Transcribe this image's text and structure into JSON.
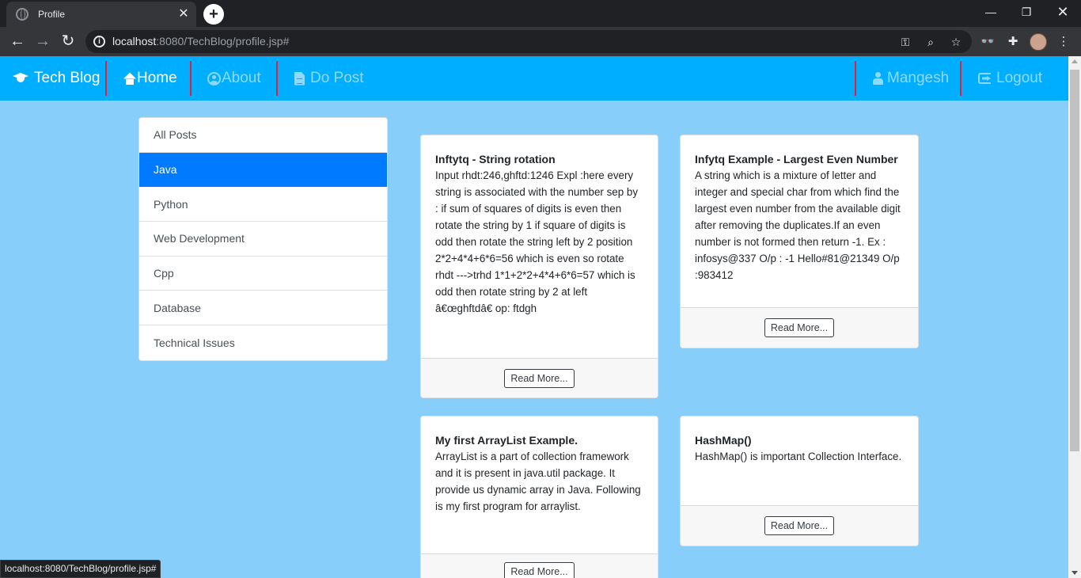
{
  "browser": {
    "tab_title": "Profile",
    "url_host": "localhost",
    "url_rest": ":8080/TechBlog/profile.jsp#",
    "status_url": "localhost:8080/TechBlog/profile.jsp#"
  },
  "navbar": {
    "brand": "Tech Blog",
    "home": "Home",
    "about": "About",
    "do_post": "Do Post",
    "user": "Mangesh",
    "logout": "Logout",
    "background": "#00aeff",
    "separator_color": "#d9253b"
  },
  "categories": [
    {
      "label": "All Posts"
    },
    {
      "label": "Java",
      "active": true
    },
    {
      "label": "Python"
    },
    {
      "label": "Web Development"
    },
    {
      "label": "Cpp"
    },
    {
      "label": "Database"
    },
    {
      "label": "Technical Issues"
    }
  ],
  "posts": [
    {
      "title": "Inftytq - String rotation",
      "content": "Input rhdt:246,ghftd:1246 Expl :here every string is associated with the number sep by : if sum of squares of digits is even then rotate the string by 1 if square of digits is odd then rotate the string left by 2 position 2*2+4*4+6*6=56 which is even so rotate rhdt --->trhd 1*1+2*2+4*4+6*6=57 which is odd then rotate string by 2 at left â€œghftdâ€ op: ftdgh",
      "button": "Read More..."
    },
    {
      "title": "Infytq Example - Largest Even Number",
      "content": "A string which is a mixture of letter and integer and special char from which find the largest even number from the available digit after removing the duplicates.If an even number is not formed then return -1. Ex : infosys@337 O/p : -1 Hello#81@21349 O/p :983412",
      "button": "Read More..."
    },
    {
      "title": "My first ArrayList Example.",
      "content": "ArrayList is a part of collection framework and it is present in java.util package. It provide us dynamic array in Java. Following is my first program for arraylist.",
      "button": "Read More..."
    },
    {
      "title": "HashMap()",
      "content": "HashMap() is important Collection Interface.",
      "button": "Read More..."
    }
  ],
  "colors": {
    "page_background": "#87cefa",
    "active_category": "#007bff"
  }
}
